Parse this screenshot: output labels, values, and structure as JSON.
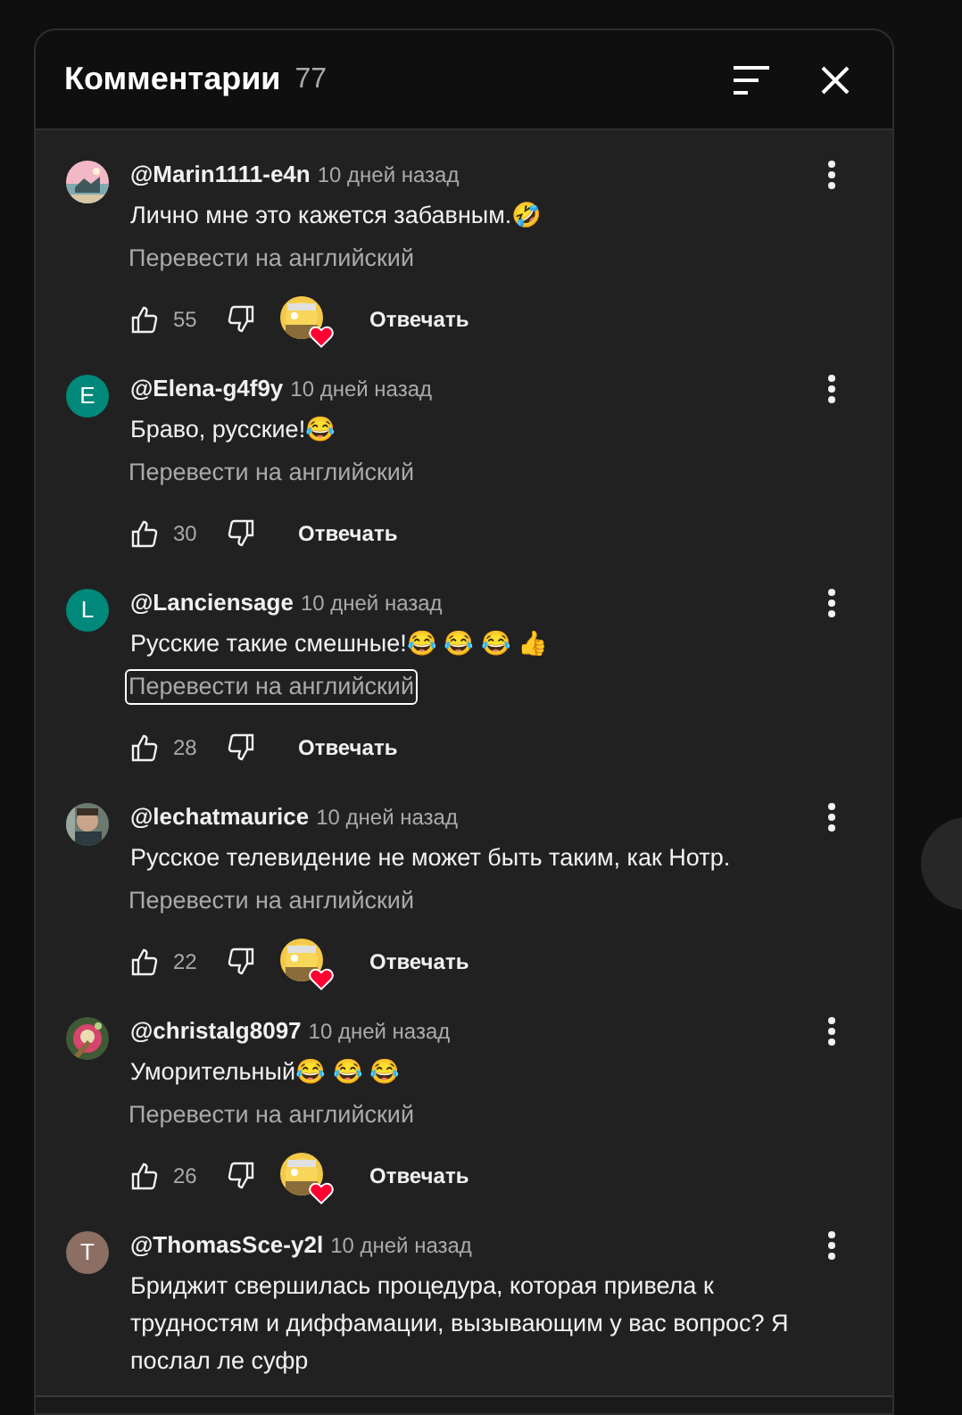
{
  "header": {
    "title": "Комментарии",
    "count": "77"
  },
  "comments": [
    {
      "author": "@Marin1111-e4n",
      "time": "10 дней назад",
      "text": "Лично мне это кажется забавным.🤣",
      "translate": {
        "label": "Перевести на английский",
        "focused": false
      },
      "likes": "55",
      "creator_heart": true,
      "reply": "Отвечать"
    },
    {
      "avatar": {
        "kind": "letter",
        "letter": "E",
        "color": "#00897b"
      },
      "author": "@Elena-g4f9y",
      "time": "10 дней назад",
      "text": "Браво, русские!😂",
      "translate": {
        "label": "Перевести на английский",
        "focused": false
      },
      "likes": "30",
      "creator_heart": false,
      "reply": "Отвечать"
    },
    {
      "avatar": {
        "kind": "letter",
        "letter": "L",
        "color": "#00897b"
      },
      "author": "@Lanciensage",
      "time": "10 дней назад",
      "text": "Русские такие смешные!😂 😂 😂 👍",
      "translate": {
        "label": "Перевести на английский",
        "focused": true
      },
      "likes": "28",
      "creator_heart": false,
      "reply": "Отвечать"
    },
    {
      "author": "@lechatmaurice",
      "time": "10 дней назад",
      "text": "Русское телевидение не может быть таким, как Нотр.",
      "translate": {
        "label": "Перевести на английский",
        "focused": false
      },
      "likes": "22",
      "creator_heart": true,
      "reply": "Отвечать"
    },
    {
      "author": "@christalg8097",
      "time": "10 дней назад",
      "text": "Уморительный😂 😂 😂",
      "translate": {
        "label": "Перевести на английский",
        "focused": false
      },
      "likes": "26",
      "creator_heart": true,
      "reply": "Отвечать"
    },
    {
      "avatar": {
        "kind": "letter",
        "letter": "T",
        "color": "#8d6e63"
      },
      "author": "@ThomasSce-y2l",
      "time": "10 дней назад",
      "text": "Бриджит свершилась процедура, которая привела к трудностям и диффамации, вызывающим у вас вопрос? Я послал ле суфр"
    }
  ]
}
